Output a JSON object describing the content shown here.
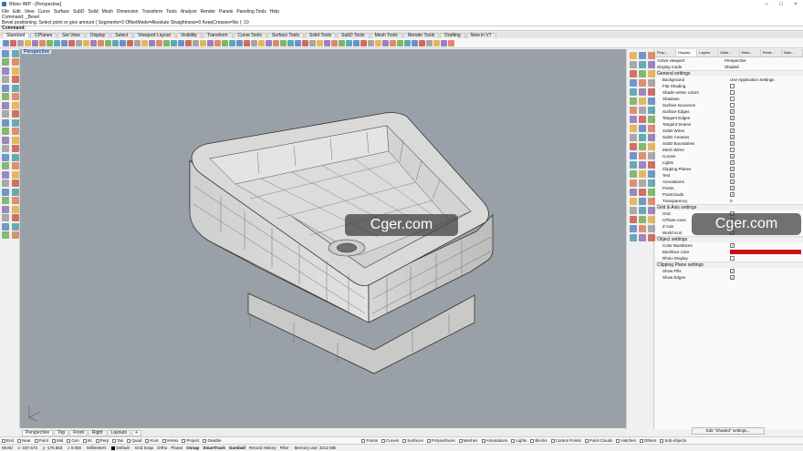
{
  "window": {
    "title": "Rhino WIP - [Perspective]"
  },
  "menu": [
    "File",
    "Edit",
    "View",
    "Curve",
    "Surface",
    "SubD",
    "Solid",
    "Mesh",
    "Dimension",
    "Transform",
    "Tools",
    "Analyze",
    "Render",
    "Panels",
    "Paneling Tools",
    "Help"
  ],
  "command_history": [
    "Command: _Bevel",
    "Bevel positioning. Select point or give amount ( Segments=3  OffsetMode=Absolute  Straightness=0  KeepCreases=No ): 10"
  ],
  "command_prompt": "Command:",
  "toolbar_tabs": [
    "Standard",
    "CPlanes",
    "Set View",
    "Display",
    "Select",
    "Viewport Layout",
    "Visibility",
    "Transform",
    "Curve Tools",
    "Surface Tools",
    "Solid Tools",
    "SubD Tools",
    "Mesh Tools",
    "Render Tools",
    "Drafting",
    "New in V7"
  ],
  "viewport": {
    "label": "Perspective",
    "background": "#9aa0a7"
  },
  "watermarks": [
    "Cger.com",
    "Cger.com"
  ],
  "panel": {
    "tabs": [
      "Prop...",
      "Display",
      "Layers",
      "Mate...",
      "Nam...",
      "Rend...",
      "Nam..."
    ],
    "top_rows": [
      {
        "label": "Active viewport",
        "value": "Perspective"
      },
      {
        "label": "Display mode",
        "value": "Shaded"
      }
    ],
    "sections": [
      {
        "header": "General settings",
        "rows": [
          {
            "label": "Background",
            "type": "text",
            "value": "Use Application Settings"
          },
          {
            "label": "Flat Shading",
            "type": "check",
            "checked": false
          },
          {
            "label": "Shade vertex colors",
            "type": "check",
            "checked": false
          },
          {
            "label": "Shadows",
            "type": "check",
            "checked": false
          },
          {
            "label": "Surface Isocurves",
            "type": "check",
            "checked": false
          },
          {
            "label": "Surface Edges",
            "type": "check",
            "checked": true
          },
          {
            "label": "Tangent Edges",
            "type": "check",
            "checked": true
          },
          {
            "label": "Tangent Seams",
            "type": "check",
            "checked": true
          },
          {
            "label": "SubD Wires",
            "type": "check",
            "checked": true
          },
          {
            "label": "SubD Creases",
            "type": "check",
            "checked": true
          },
          {
            "label": "SubD Boundaries",
            "type": "check",
            "checked": true
          },
          {
            "label": "Mesh Wires",
            "type": "check",
            "checked": false
          },
          {
            "label": "Curves",
            "type": "check",
            "checked": true
          },
          {
            "label": "Lights",
            "type": "check",
            "checked": true
          },
          {
            "label": "Clipping Planes",
            "type": "check",
            "checked": true
          },
          {
            "label": "Text",
            "type": "check",
            "checked": true
          },
          {
            "label": "Annotations",
            "type": "check",
            "checked": true
          },
          {
            "label": "Points",
            "type": "check",
            "checked": true
          },
          {
            "label": "Pointclouds",
            "type": "check",
            "checked": true
          },
          {
            "label": "Transparency",
            "type": "text",
            "value": "0"
          }
        ]
      },
      {
        "header": "Grid & Axis settings",
        "rows": [
          {
            "label": "Grid",
            "type": "check",
            "checked": false
          },
          {
            "label": "CPlane Axes",
            "type": "check",
            "checked": false
          },
          {
            "label": "Z Axis",
            "type": "check",
            "checked": false
          },
          {
            "label": "World Icon",
            "type": "check",
            "checked": true
          }
        ]
      },
      {
        "header": "Object settings",
        "rows": [
          {
            "label": "Color Backfaces",
            "type": "check",
            "checked": true
          },
          {
            "label": "Backface color",
            "type": "swatch",
            "color": "#cc1010"
          },
          {
            "label": "Rhino Display",
            "type": "check",
            "checked": false
          }
        ]
      },
      {
        "header": "Clipping Plane settings",
        "rows": [
          {
            "label": "Show Fills",
            "type": "check",
            "checked": true
          },
          {
            "label": "Show Edges",
            "type": "check",
            "checked": true
          }
        ]
      }
    ],
    "edit_button": "Edit \"Shaded\" settings..."
  },
  "viewport_tabs": [
    "Perspective",
    "Top",
    "Front",
    "Right",
    "Layouts",
    "+"
  ],
  "osnaps_left": [
    "End",
    "Near",
    "Point",
    "Mid",
    "Cen",
    "Int",
    "Perp",
    "Tan",
    "Quad",
    "Knot",
    "Vertex",
    "Project",
    "Disable"
  ],
  "osnaps_right": [
    "Points",
    "Curves",
    "Surfaces",
    "Polysurfaces",
    "Meshes",
    "Annotations",
    "Lights",
    "Blocks",
    "Control Points",
    "Point Clouds",
    "Hatches",
    "Others",
    "Sub-objects"
  ],
  "status": {
    "world": "World",
    "x": "x -197.573",
    "y": "y -175.883",
    "z": "z 0.000",
    "units": "Millimeters",
    "layer": "Default",
    "toggles": [
      "Grid Snap",
      "Ortho",
      "Planar",
      "Osnap",
      "SmartTrack",
      "Gumball",
      "Record History",
      "Filter"
    ],
    "memory": "Memory use: 3212 MB"
  },
  "colors": {
    "viewport": "#9aa0a7",
    "model_surface": "#d8d8d6",
    "accent": "#cc1010"
  }
}
